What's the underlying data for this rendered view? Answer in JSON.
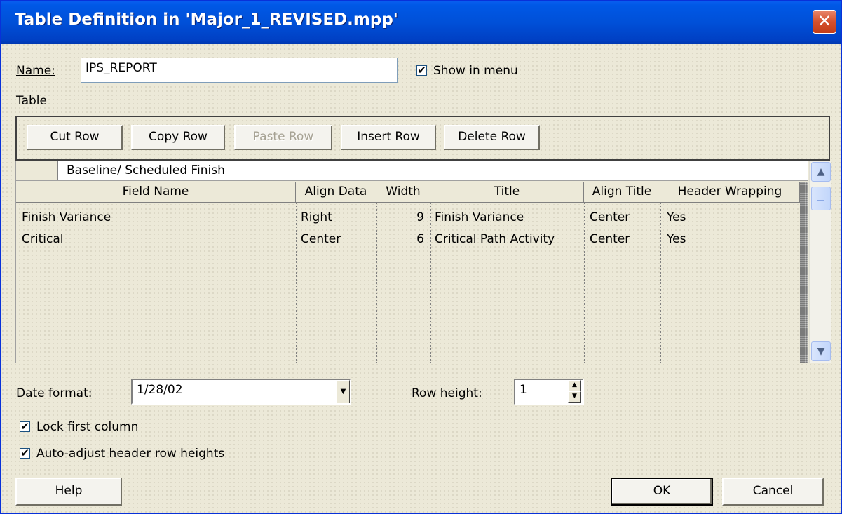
{
  "window": {
    "title": "Table Definition in 'Major_1_REVISED.mpp'",
    "close_glyph": "✕"
  },
  "name_field": {
    "label": "Name:",
    "value": "IPS_REPORT"
  },
  "show_in_menu": {
    "label": "Show in menu",
    "checked": true,
    "check_glyph": "✔"
  },
  "table_section": {
    "label": "Table"
  },
  "toolbar": {
    "cut_row": "Cut Row",
    "copy_row": "Copy Row",
    "paste_row": "Paste Row",
    "insert_row": "Insert Row",
    "delete_row": "Delete Row"
  },
  "grid": {
    "edit_value": "Baseline/ Scheduled Finish",
    "columns": [
      "Field Name",
      "Align Data",
      "Width",
      "Title",
      "Align Title",
      "Header Wrapping"
    ],
    "rows": [
      [
        "Finish Variance",
        "Right",
        "9",
        "Finish Variance",
        "Center",
        "Yes"
      ],
      [
        "Critical",
        "Center",
        "6",
        "Critical Path Activity",
        "Center",
        "Yes"
      ]
    ],
    "scroll_up_glyph": "▲",
    "scroll_down_glyph": "▼"
  },
  "date_format": {
    "label": "Date format:",
    "value": "1/28/02",
    "arrow_glyph": "▼"
  },
  "row_height": {
    "label": "Row height:",
    "value": "1",
    "up_glyph": "▲",
    "down_glyph": "▼"
  },
  "lock_first_column": {
    "label": "Lock first column",
    "checked": true,
    "check_glyph": "✔"
  },
  "auto_adjust": {
    "label": "Auto-adjust header row heights",
    "checked": true,
    "check_glyph": "✔"
  },
  "buttons": {
    "help": "Help",
    "ok": "OK",
    "cancel": "Cancel"
  },
  "colors": {
    "titlebar": "#0050d8",
    "dialog_bg": "#ece9d8",
    "close_button": "#d4502d"
  }
}
